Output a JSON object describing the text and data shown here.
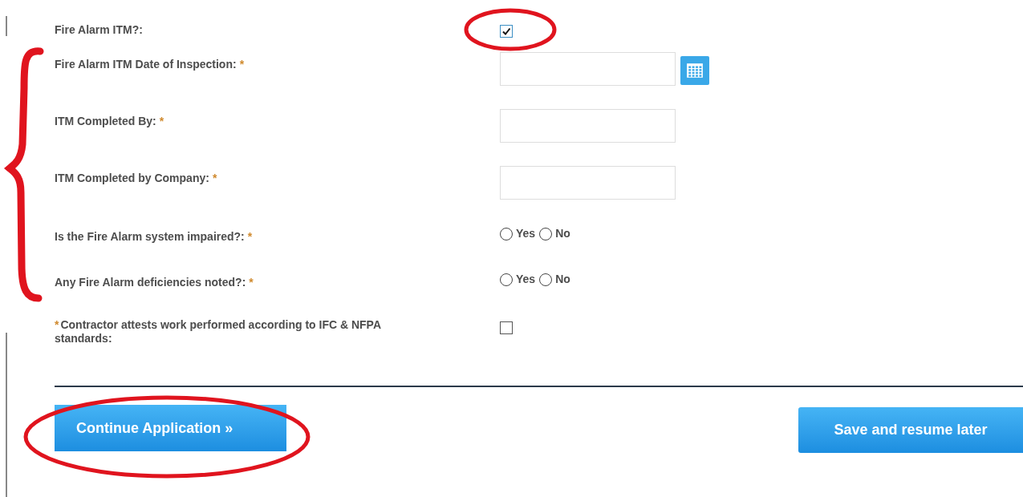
{
  "fields": [
    {
      "kind": "checkbox",
      "label": "Fire Alarm ITM?:",
      "required": false,
      "checked": true
    },
    {
      "kind": "date",
      "label": "Fire Alarm ITM Date of Inspection:",
      "required": true
    },
    {
      "kind": "text",
      "label": "ITM Completed By:",
      "required": true
    },
    {
      "kind": "text",
      "label": "ITM Completed by Company:",
      "required": true
    },
    {
      "kind": "radio",
      "label": "Is the Fire Alarm system impaired?:",
      "required": true,
      "options": [
        {
          "label": "Yes",
          "selected": false
        },
        {
          "label": "No",
          "selected": false
        }
      ]
    },
    {
      "kind": "radio",
      "label": "Any Fire Alarm deficiencies noted?:",
      "required": true,
      "options": [
        {
          "label": "Yes",
          "selected": false
        },
        {
          "label": "No",
          "selected": false
        }
      ]
    }
  ],
  "attestation": {
    "required_mark": "*",
    "label": "Contractor attests work performed according to IFC & NFPA standards:",
    "checked": false
  },
  "required_mark": "*",
  "buttons": [
    {
      "label": "Continue Application »"
    },
    {
      "label": "Save and resume later"
    }
  ]
}
